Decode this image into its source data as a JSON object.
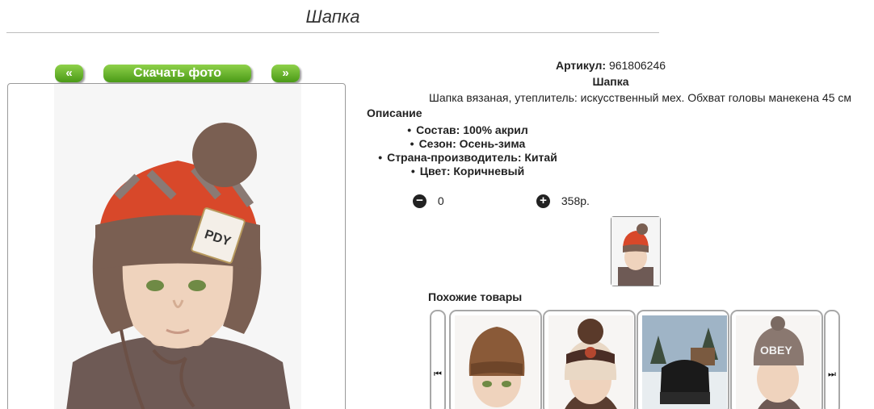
{
  "page": {
    "title": "Шапка"
  },
  "gallery": {
    "prev_label": "«",
    "download_label": "Скачать фото",
    "next_label": "»",
    "badge_text": "PDY"
  },
  "product": {
    "article_label": "Артикул:",
    "article_value": "961806246",
    "name": "Шапка",
    "description": "Шапка вязаная, утеплитель: искусственный мех. Обхват головы манекена 45 см",
    "desc_heading": "Описание",
    "properties": [
      "Состав: 100% акрил",
      "Сезон: Осень-зима",
      "Страна-производитель: Китай",
      "Цвет: Коричневый"
    ]
  },
  "cart": {
    "minus_symbol": "−",
    "quantity": "0",
    "plus_symbol": "+",
    "price": "358р."
  },
  "similar": {
    "heading": "Похожие товары",
    "prev_glyph": "⏮",
    "next_glyph": "⏭",
    "card4_text": "OBEY"
  },
  "colors": {
    "button_green": "#4a9a17",
    "hat_brown": "#7a5f52",
    "hat_red": "#d8482a"
  }
}
